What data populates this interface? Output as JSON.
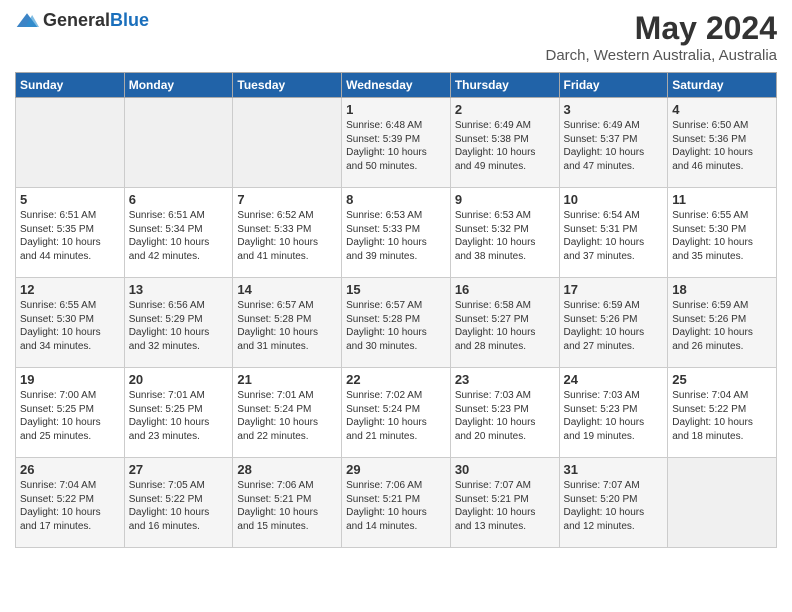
{
  "logo": {
    "general": "General",
    "blue": "Blue"
  },
  "header": {
    "title": "May 2024",
    "subtitle": "Darch, Western Australia, Australia"
  },
  "days_of_week": [
    "Sunday",
    "Monday",
    "Tuesday",
    "Wednesday",
    "Thursday",
    "Friday",
    "Saturday"
  ],
  "weeks": [
    [
      {
        "day": "",
        "info": ""
      },
      {
        "day": "",
        "info": ""
      },
      {
        "day": "",
        "info": ""
      },
      {
        "day": "1",
        "info": "Sunrise: 6:48 AM\nSunset: 5:39 PM\nDaylight: 10 hours\nand 50 minutes."
      },
      {
        "day": "2",
        "info": "Sunrise: 6:49 AM\nSunset: 5:38 PM\nDaylight: 10 hours\nand 49 minutes."
      },
      {
        "day": "3",
        "info": "Sunrise: 6:49 AM\nSunset: 5:37 PM\nDaylight: 10 hours\nand 47 minutes."
      },
      {
        "day": "4",
        "info": "Sunrise: 6:50 AM\nSunset: 5:36 PM\nDaylight: 10 hours\nand 46 minutes."
      }
    ],
    [
      {
        "day": "5",
        "info": "Sunrise: 6:51 AM\nSunset: 5:35 PM\nDaylight: 10 hours\nand 44 minutes."
      },
      {
        "day": "6",
        "info": "Sunrise: 6:51 AM\nSunset: 5:34 PM\nDaylight: 10 hours\nand 42 minutes."
      },
      {
        "day": "7",
        "info": "Sunrise: 6:52 AM\nSunset: 5:33 PM\nDaylight: 10 hours\nand 41 minutes."
      },
      {
        "day": "8",
        "info": "Sunrise: 6:53 AM\nSunset: 5:33 PM\nDaylight: 10 hours\nand 39 minutes."
      },
      {
        "day": "9",
        "info": "Sunrise: 6:53 AM\nSunset: 5:32 PM\nDaylight: 10 hours\nand 38 minutes."
      },
      {
        "day": "10",
        "info": "Sunrise: 6:54 AM\nSunset: 5:31 PM\nDaylight: 10 hours\nand 37 minutes."
      },
      {
        "day": "11",
        "info": "Sunrise: 6:55 AM\nSunset: 5:30 PM\nDaylight: 10 hours\nand 35 minutes."
      }
    ],
    [
      {
        "day": "12",
        "info": "Sunrise: 6:55 AM\nSunset: 5:30 PM\nDaylight: 10 hours\nand 34 minutes."
      },
      {
        "day": "13",
        "info": "Sunrise: 6:56 AM\nSunset: 5:29 PM\nDaylight: 10 hours\nand 32 minutes."
      },
      {
        "day": "14",
        "info": "Sunrise: 6:57 AM\nSunset: 5:28 PM\nDaylight: 10 hours\nand 31 minutes."
      },
      {
        "day": "15",
        "info": "Sunrise: 6:57 AM\nSunset: 5:28 PM\nDaylight: 10 hours\nand 30 minutes."
      },
      {
        "day": "16",
        "info": "Sunrise: 6:58 AM\nSunset: 5:27 PM\nDaylight: 10 hours\nand 28 minutes."
      },
      {
        "day": "17",
        "info": "Sunrise: 6:59 AM\nSunset: 5:26 PM\nDaylight: 10 hours\nand 27 minutes."
      },
      {
        "day": "18",
        "info": "Sunrise: 6:59 AM\nSunset: 5:26 PM\nDaylight: 10 hours\nand 26 minutes."
      }
    ],
    [
      {
        "day": "19",
        "info": "Sunrise: 7:00 AM\nSunset: 5:25 PM\nDaylight: 10 hours\nand 25 minutes."
      },
      {
        "day": "20",
        "info": "Sunrise: 7:01 AM\nSunset: 5:25 PM\nDaylight: 10 hours\nand 23 minutes."
      },
      {
        "day": "21",
        "info": "Sunrise: 7:01 AM\nSunset: 5:24 PM\nDaylight: 10 hours\nand 22 minutes."
      },
      {
        "day": "22",
        "info": "Sunrise: 7:02 AM\nSunset: 5:24 PM\nDaylight: 10 hours\nand 21 minutes."
      },
      {
        "day": "23",
        "info": "Sunrise: 7:03 AM\nSunset: 5:23 PM\nDaylight: 10 hours\nand 20 minutes."
      },
      {
        "day": "24",
        "info": "Sunrise: 7:03 AM\nSunset: 5:23 PM\nDaylight: 10 hours\nand 19 minutes."
      },
      {
        "day": "25",
        "info": "Sunrise: 7:04 AM\nSunset: 5:22 PM\nDaylight: 10 hours\nand 18 minutes."
      }
    ],
    [
      {
        "day": "26",
        "info": "Sunrise: 7:04 AM\nSunset: 5:22 PM\nDaylight: 10 hours\nand 17 minutes."
      },
      {
        "day": "27",
        "info": "Sunrise: 7:05 AM\nSunset: 5:22 PM\nDaylight: 10 hours\nand 16 minutes."
      },
      {
        "day": "28",
        "info": "Sunrise: 7:06 AM\nSunset: 5:21 PM\nDaylight: 10 hours\nand 15 minutes."
      },
      {
        "day": "29",
        "info": "Sunrise: 7:06 AM\nSunset: 5:21 PM\nDaylight: 10 hours\nand 14 minutes."
      },
      {
        "day": "30",
        "info": "Sunrise: 7:07 AM\nSunset: 5:21 PM\nDaylight: 10 hours\nand 13 minutes."
      },
      {
        "day": "31",
        "info": "Sunrise: 7:07 AM\nSunset: 5:20 PM\nDaylight: 10 hours\nand 12 minutes."
      },
      {
        "day": "",
        "info": ""
      }
    ]
  ]
}
